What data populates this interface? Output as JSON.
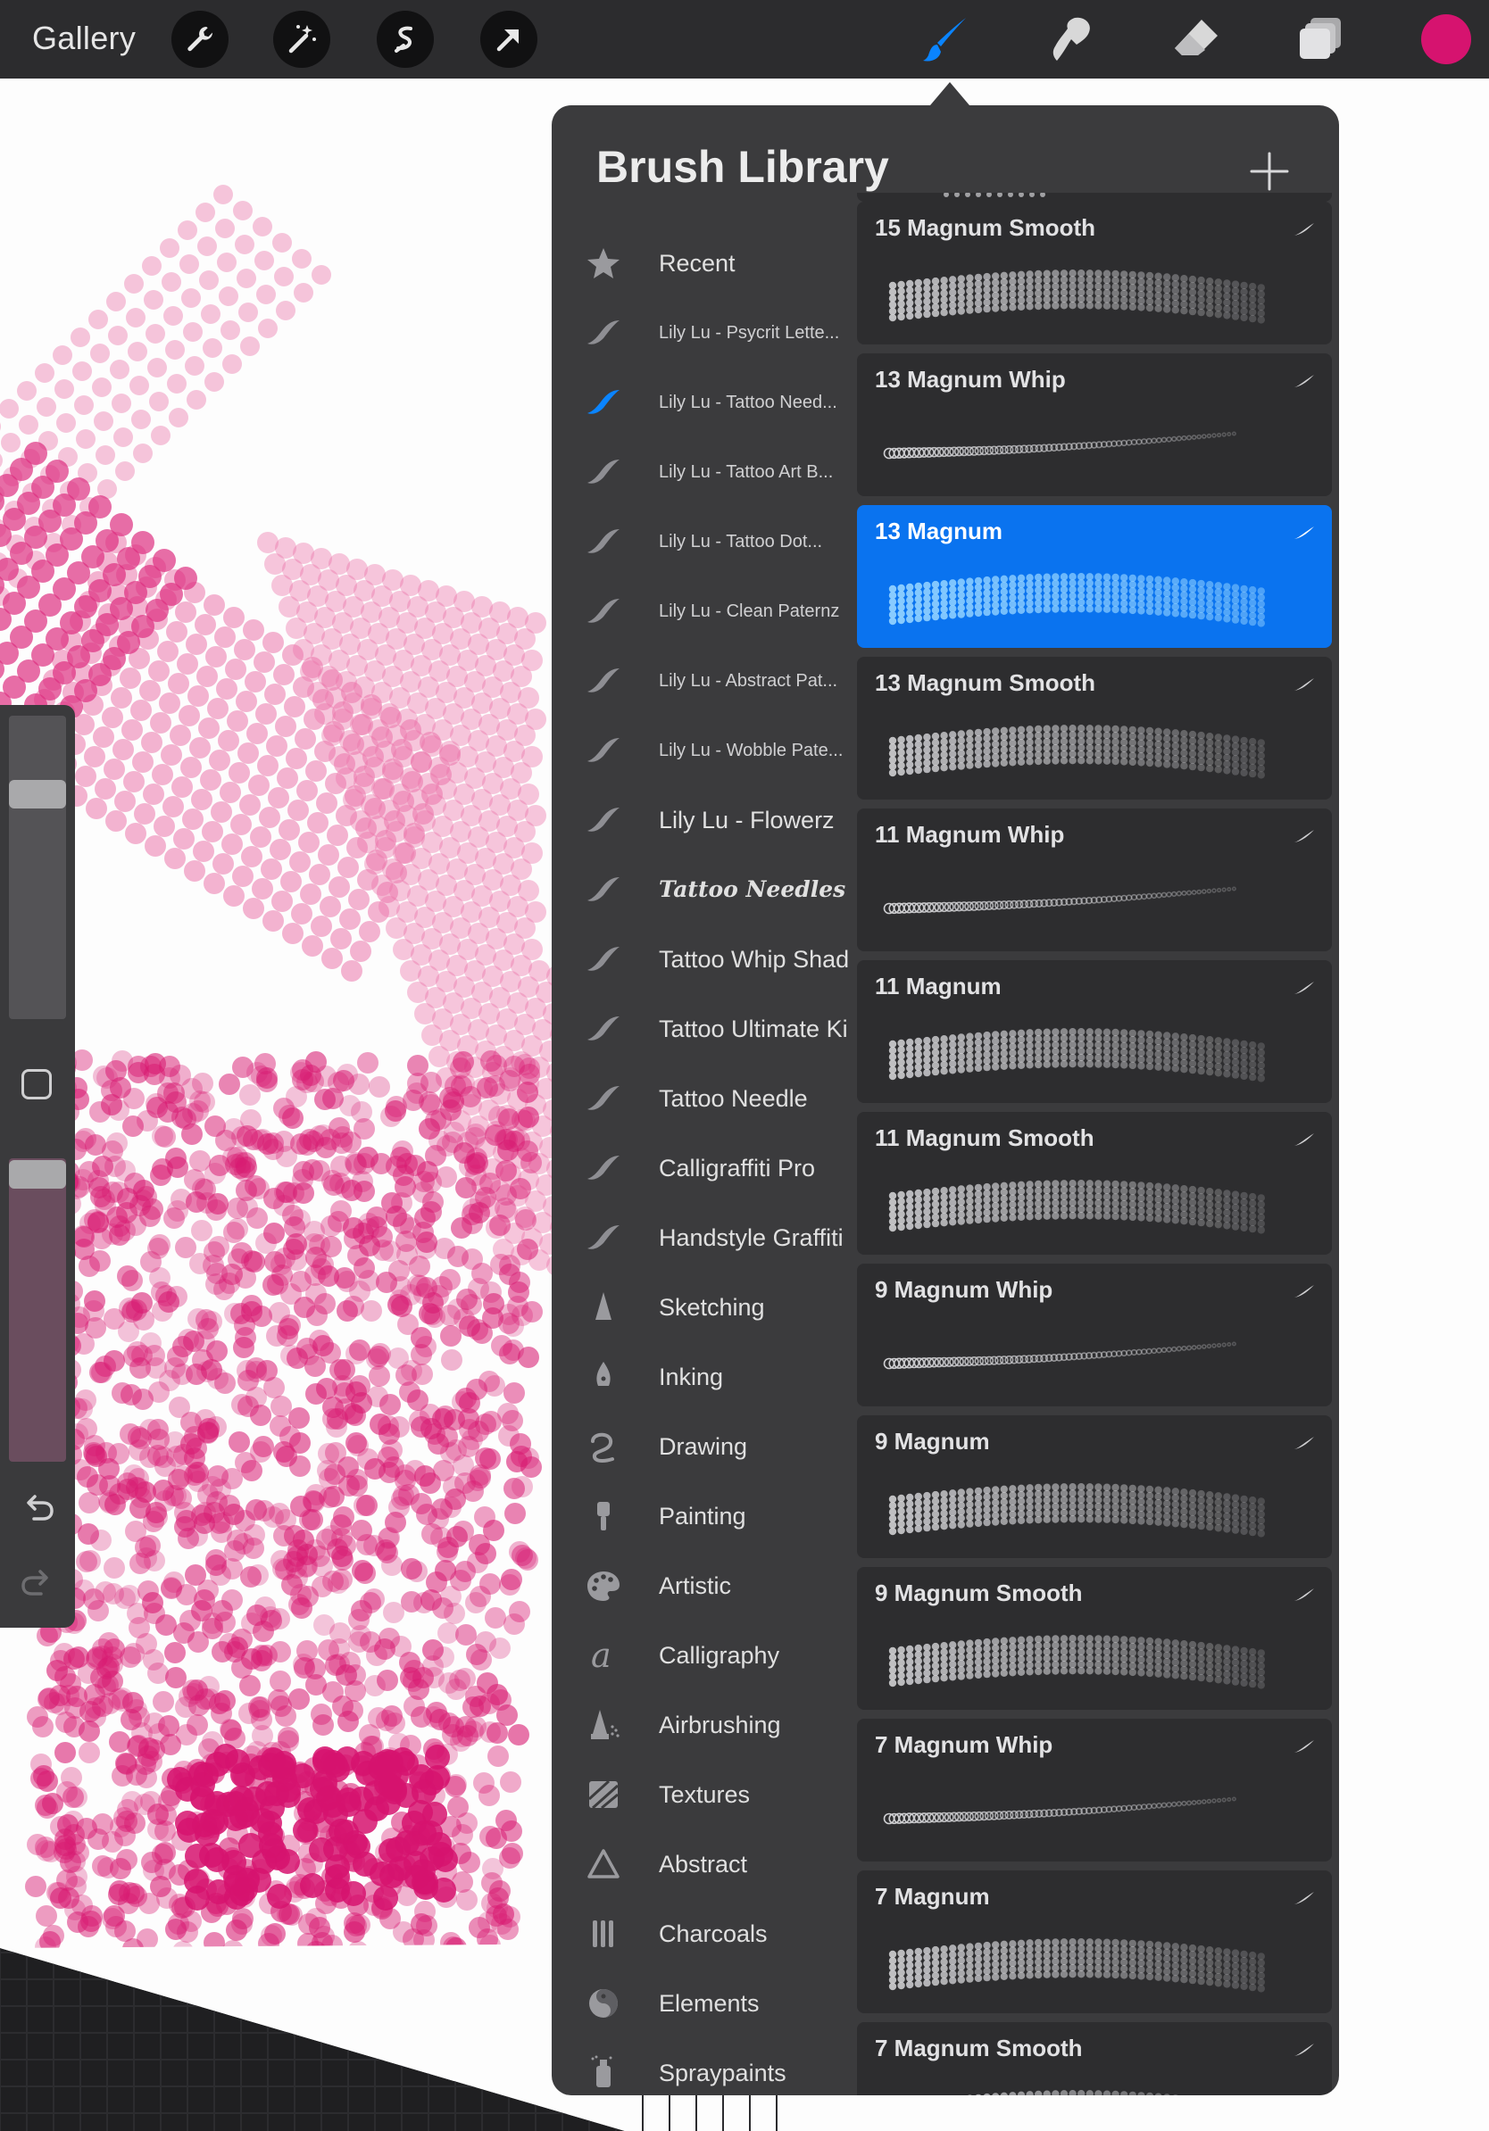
{
  "topbar": {
    "gallery_label": "Gallery",
    "tools": [
      "wrench-icon",
      "magic-wand-icon",
      "selection-icon",
      "transform-arrow-icon"
    ],
    "right_tools": [
      "brush-icon",
      "smudge-icon",
      "eraser-icon",
      "layers-icon"
    ],
    "active_tool": "brush",
    "current_color": "#d6136f"
  },
  "library": {
    "title": "Brush Library",
    "sets": [
      {
        "label": "Recent",
        "icon": "star-icon"
      },
      {
        "label": "Lily Lu - Psycrit Lette...",
        "icon": "brush-stroke-icon"
      },
      {
        "label": "Lily Lu - Tattoo Need...",
        "icon": "brush-stroke-icon",
        "selected": true
      },
      {
        "label": "Lily Lu - Tattoo Art B...",
        "icon": "brush-stroke-icon"
      },
      {
        "label": "Lily Lu - Tattoo Dot...",
        "icon": "brush-stroke-icon"
      },
      {
        "label": "Lily Lu - Clean Paternz",
        "icon": "brush-stroke-icon"
      },
      {
        "label": "Lily Lu - Abstract Pat...",
        "icon": "brush-stroke-icon"
      },
      {
        "label": "Lily Lu - Wobble Pate...",
        "icon": "brush-stroke-icon"
      },
      {
        "label": "Lily Lu - Flowerz",
        "icon": "brush-stroke-icon"
      },
      {
        "label": "Tattoo Needles",
        "icon": "brush-stroke-icon"
      },
      {
        "label": "Tattoo Whip Shade",
        "icon": "brush-stroke-icon"
      },
      {
        "label": "Tattoo Ultimate Kit",
        "icon": "brush-stroke-icon"
      },
      {
        "label": "Tattoo Needle",
        "icon": "brush-stroke-icon"
      },
      {
        "label": "Calligraffiti Pro",
        "icon": "brush-stroke-icon"
      },
      {
        "label": "Handstyle Graffiti",
        "icon": "brush-stroke-icon"
      },
      {
        "label": "Sketching",
        "icon": "pencil-tip-icon"
      },
      {
        "label": "Inking",
        "icon": "pen-nib-icon"
      },
      {
        "label": "Drawing",
        "icon": "squiggle-icon"
      },
      {
        "label": "Painting",
        "icon": "paint-brush-icon"
      },
      {
        "label": "Artistic",
        "icon": "palette-icon"
      },
      {
        "label": "Calligraphy",
        "icon": "calligraphy-a-icon"
      },
      {
        "label": "Airbrushing",
        "icon": "airbrush-icon"
      },
      {
        "label": "Textures",
        "icon": "texture-icon"
      },
      {
        "label": "Abstract",
        "icon": "triangle-icon"
      },
      {
        "label": "Charcoals",
        "icon": "charcoal-icon"
      },
      {
        "label": "Elements",
        "icon": "yin-yang-icon"
      },
      {
        "label": "Spraypaints",
        "icon": "spray-can-icon"
      }
    ],
    "brushes": [
      {
        "name": "15 Magnum Smooth",
        "style": "band"
      },
      {
        "name": "13 Magnum Whip",
        "style": "whip"
      },
      {
        "name": "13 Magnum",
        "style": "band",
        "selected": true
      },
      {
        "name": "13 Magnum Smooth",
        "style": "band"
      },
      {
        "name": "11 Magnum Whip",
        "style": "whip"
      },
      {
        "name": "11 Magnum",
        "style": "band"
      },
      {
        "name": "11 Magnum Smooth",
        "style": "band"
      },
      {
        "name": "9 Magnum  Whip",
        "style": "whip"
      },
      {
        "name": "9 Magnum",
        "style": "band"
      },
      {
        "name": "9 Magnum Smooth",
        "style": "band"
      },
      {
        "name": "7 Magnum Whip",
        "style": "whip"
      },
      {
        "name": "7 Magnum",
        "style": "band"
      },
      {
        "name": "7 Magnum Smooth",
        "style": "band"
      }
    ]
  },
  "colors": {
    "selected_blue": "#0a73ef",
    "paint_pink": "#d6136f"
  }
}
